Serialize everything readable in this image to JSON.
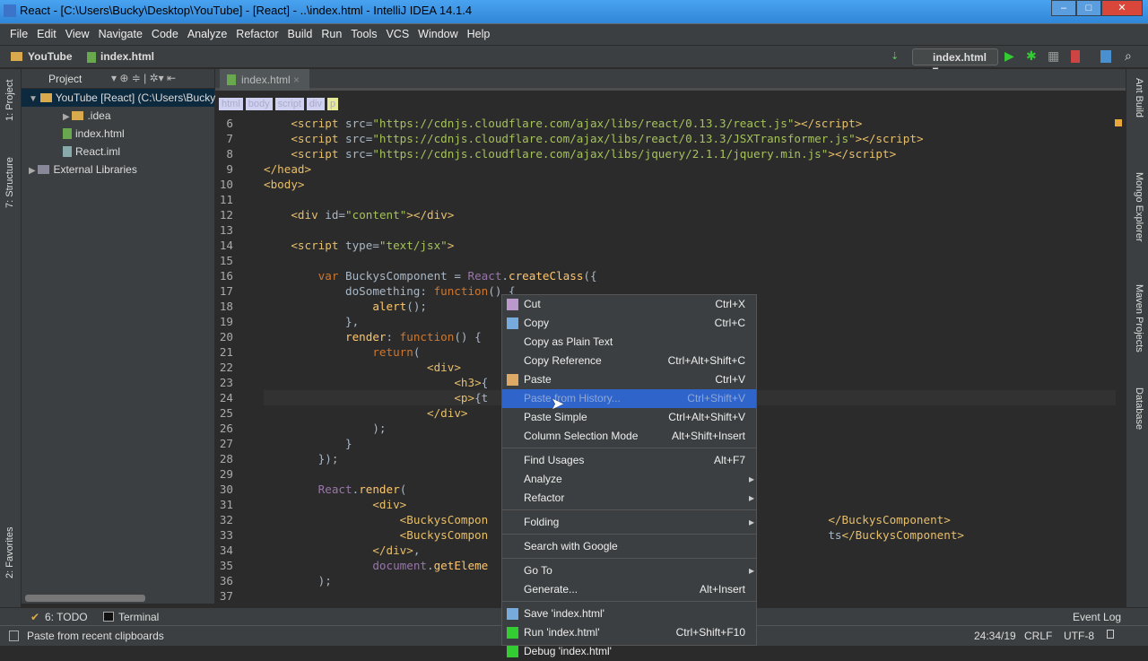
{
  "window": {
    "title": "React - [C:\\Users\\Bucky\\Desktop\\YouTube] - [React] - ..\\index.html - IntelliJ IDEA 14.1.4"
  },
  "menu": [
    "File",
    "Edit",
    "View",
    "Navigate",
    "Code",
    "Analyze",
    "Refactor",
    "Build",
    "Run",
    "Tools",
    "VCS",
    "Window",
    "Help"
  ],
  "nav": {
    "project": "YouTube",
    "file": "index.html",
    "run_config": "index.html"
  },
  "left_strip": {
    "project": "1: Project",
    "structure": "7: Structure",
    "favorites": "2: Favorites"
  },
  "right_strip": [
    "Ant Build",
    "Mongo Explorer",
    "Maven Projects",
    "Database"
  ],
  "project": {
    "header": "Project",
    "items": [
      {
        "label": "YouTube [React] (C:\\Users\\Bucky",
        "type": "root"
      },
      {
        "label": ".idea",
        "type": "folder"
      },
      {
        "label": "index.html",
        "type": "html"
      },
      {
        "label": "React.iml",
        "type": "file"
      },
      {
        "label": "External Libraries",
        "type": "lib"
      }
    ]
  },
  "editor": {
    "tab": "index.html",
    "tags": [
      "html",
      "body",
      "script",
      "div",
      "p"
    ],
    "lines": [
      6,
      7,
      8,
      9,
      10,
      11,
      12,
      13,
      14,
      15,
      16,
      17,
      18,
      19,
      20,
      21,
      22,
      23,
      24,
      25,
      26,
      27,
      28,
      29,
      30,
      31,
      32,
      33,
      34,
      35,
      36,
      37
    ],
    "code": [
      "    <script src=\"https://cdnjs.cloudflare.com/ajax/libs/react/0.13.3/react.js\"></script>",
      "    <script src=\"https://cdnjs.cloudflare.com/ajax/libs/react/0.13.3/JSXTransformer.js\"></script>",
      "    <script src=\"https://cdnjs.cloudflare.com/ajax/libs/jquery/2.1.1/jquery.min.js\"></script>",
      "</head>",
      "<body>",
      "",
      "    <div id=\"content\"></div>",
      "",
      "    <script type=\"text/jsx\">",
      "",
      "        var BuckysComponent = React.createClass({",
      "            doSomething: function() {",
      "                alert();",
      "            },",
      "            render: function() {",
      "                return(",
      "                        <div>",
      "                            <h3>{",
      "                            <p>{t",
      "                        </div>",
      "                );",
      "            }",
      "        });",
      "",
      "        React.render(",
      "                <div>",
      "                    <BuckysCompon                                                  </BuckysComponent>",
      "                    <BuckysCompon                                                  ts</BuckysComponent>",
      "                </div>,",
      "                document.getEleme",
      "        );",
      ""
    ]
  },
  "context_menu": [
    {
      "label": "Cut",
      "shortcut": "Ctrl+X",
      "icon": "scissors-icon"
    },
    {
      "label": "Copy",
      "shortcut": "Ctrl+C",
      "icon": "copy-icon"
    },
    {
      "label": "Copy as Plain Text",
      "shortcut": ""
    },
    {
      "label": "Copy Reference",
      "shortcut": "Ctrl+Alt+Shift+C"
    },
    {
      "label": "Paste",
      "shortcut": "Ctrl+V",
      "icon": "paste-icon"
    },
    {
      "label": "Paste from History...",
      "shortcut": "Ctrl+Shift+V",
      "highlighted": true
    },
    {
      "label": "Paste Simple",
      "shortcut": "Ctrl+Alt+Shift+V"
    },
    {
      "label": "Column Selection Mode",
      "shortcut": "Alt+Shift+Insert"
    },
    {
      "sep": true
    },
    {
      "label": "Find Usages",
      "shortcut": "Alt+F7"
    },
    {
      "label": "Analyze",
      "shortcut": "",
      "submenu": true
    },
    {
      "label": "Refactor",
      "shortcut": "",
      "submenu": true
    },
    {
      "sep": true
    },
    {
      "label": "Folding",
      "shortcut": "",
      "submenu": true
    },
    {
      "sep": true
    },
    {
      "label": "Search with Google",
      "shortcut": ""
    },
    {
      "sep": true
    },
    {
      "label": "Go To",
      "shortcut": "",
      "submenu": true
    },
    {
      "label": "Generate...",
      "shortcut": "Alt+Insert"
    },
    {
      "sep": true
    },
    {
      "label": "Save 'index.html'",
      "shortcut": "",
      "icon": "save-icon"
    },
    {
      "label": "Run 'index.html'",
      "shortcut": "Ctrl+Shift+F10",
      "icon": "run-icon"
    },
    {
      "label": "Debug 'index.html'",
      "shortcut": "",
      "icon": "debug-icon"
    }
  ],
  "bottom": {
    "todo": "6: TODO",
    "terminal": "Terminal",
    "event_log": "Event Log"
  },
  "status": {
    "message": "Paste from recent clipboards",
    "position": "24:34/19",
    "line_sep": "CRLF",
    "encoding": "UTF-8"
  }
}
